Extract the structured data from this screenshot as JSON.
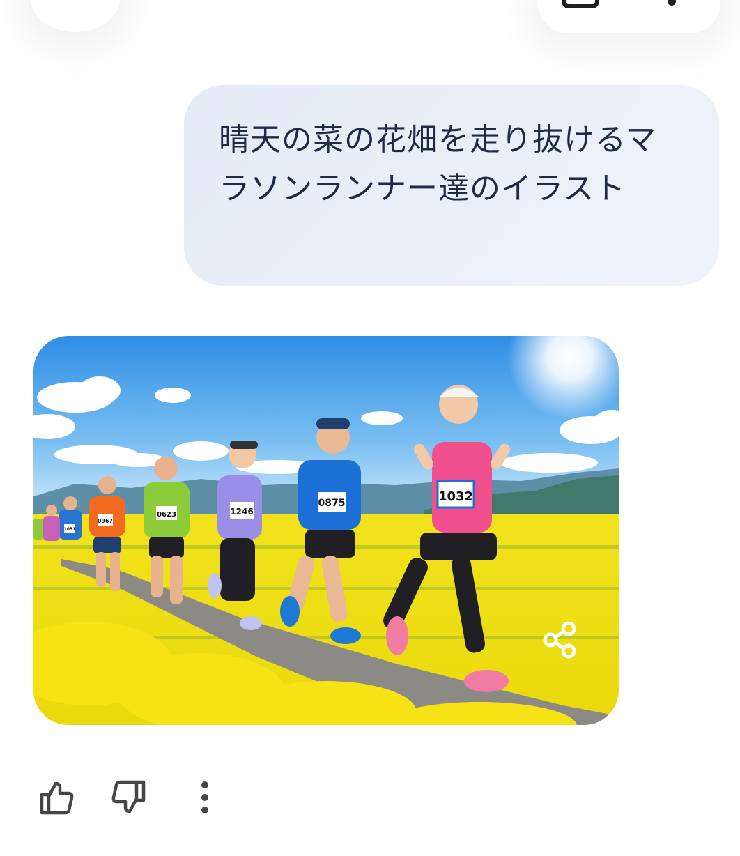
{
  "prompt": {
    "text": "晴天の菜の花畑を走り抜けるマラソンランナー達のイラスト"
  },
  "image_card": {
    "bibs": [
      "1032",
      "0875",
      "1246",
      "0623",
      "0967",
      "1051"
    ]
  },
  "actions": {
    "like_icon": "thumbs-up-icon",
    "dislike_icon": "thumbs-down-icon",
    "more_icon": "more-vertical-icon",
    "share_icon": "share-icon"
  },
  "colors": {
    "prompt_bubble": "#e8eff8",
    "prompt_text": "#1f2a44",
    "icon": "#444746"
  }
}
